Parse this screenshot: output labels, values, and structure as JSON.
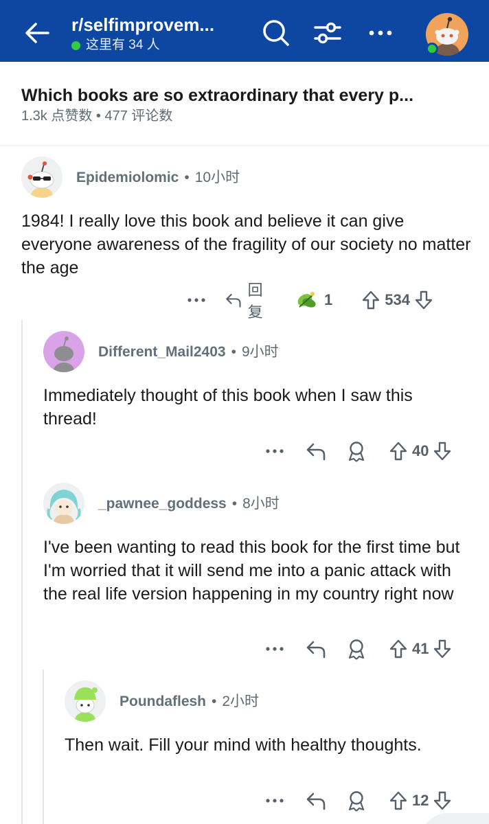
{
  "header": {
    "subreddit": "r/selfimprovem...",
    "online_text": "这里有 34 人",
    "icons": [
      "back-arrow-icon",
      "search-icon",
      "filter-icon",
      "more-icon",
      "user-avatar-icon"
    ]
  },
  "post": {
    "title": "Which books are so extraordinary that every p...",
    "stats": "1.3k 点赞数 • 477 评论数"
  },
  "comments": [
    {
      "author": "Epidemiolomic",
      "time": "10小时",
      "text": "1984! I really love this book and believe it can give everyone awareness of the fragility of our society no matter the age",
      "reply_label": "回复",
      "award_count": "1",
      "score": "534"
    },
    {
      "author": "Different_Mail2403",
      "time": "9小时",
      "text": "Immediately thought of this book when I saw this thread!",
      "score": "40"
    },
    {
      "author": "_pawnee_goddess",
      "time": "8小时",
      "text": "I've been wanting to read this book for the first time but I'm worried that it will send me into a panic attack with the real life version happening in my country right now",
      "score": "41"
    },
    {
      "author": "Poundaflesh",
      "time": "2小时",
      "text": "Then wait. Fill your mind with healthy thoughts.",
      "score": "12"
    }
  ],
  "colors": {
    "header_bg": "#0d47a1",
    "online_green": "#2ecc40",
    "text_primary": "#1a1a1b",
    "text_meta": "#5f6b73"
  }
}
